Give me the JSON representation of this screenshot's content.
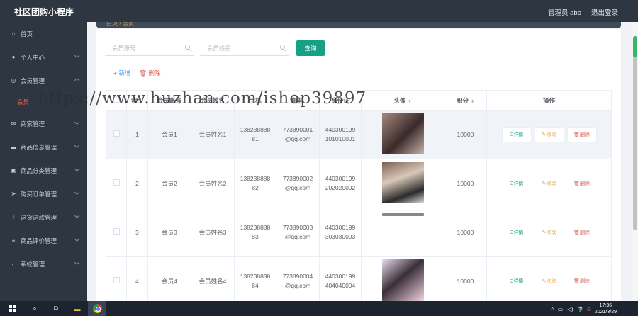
{
  "header": {
    "title": "社区团购小程序",
    "admin_label": "管理员 abo",
    "logout": "退出登录"
  },
  "sidebar": {
    "items": [
      {
        "label": "首页",
        "icon": "home-icon"
      },
      {
        "label": "个人中心",
        "icon": "user-icon"
      },
      {
        "label": "会员管理",
        "icon": "circle-icon",
        "expanded": true,
        "sub": "会员"
      },
      {
        "label": "商家管理",
        "icon": "mail-icon"
      },
      {
        "label": "商品信息管理",
        "icon": "monitor-icon"
      },
      {
        "label": "商品分类管理",
        "icon": "image-icon"
      },
      {
        "label": "购买订单管理",
        "icon": "send-icon"
      },
      {
        "label": "退货退款管理",
        "icon": "bulb-icon"
      },
      {
        "label": "商品评价管理",
        "icon": "list-icon"
      },
      {
        "label": "系统管理",
        "icon": "crop-icon"
      }
    ]
  },
  "breadcrumb": {
    "home": "首页",
    "current": "会员"
  },
  "search": {
    "account_placeholder": "会员账号",
    "name_placeholder": "会员姓名",
    "query_label": "查询"
  },
  "actions": {
    "add": "+ 新增",
    "delete": "删除"
  },
  "table": {
    "columns": [
      "",
      "索引",
      "会员账号",
      "会员姓名",
      "手机",
      "邮箱",
      "身份证",
      "头像",
      "积分",
      "操作"
    ],
    "rows": [
      {
        "index": "1",
        "account": "会员1",
        "name": "会员姓名1",
        "phone": [
          "138238888",
          "81"
        ],
        "email": [
          "773890001",
          "@qq.com"
        ],
        "idcard": [
          "440300199",
          "101010001"
        ],
        "points": "10000"
      },
      {
        "index": "2",
        "account": "会员2",
        "name": "会员姓名2",
        "phone": [
          "138238888",
          "82"
        ],
        "email": [
          "773890002",
          "@qq.com"
        ],
        "idcard": [
          "440300199",
          "202020002"
        ],
        "points": "10000"
      },
      {
        "index": "3",
        "account": "会员3",
        "name": "会员姓名3",
        "phone": [
          "138238888",
          "83"
        ],
        "email": [
          "773890003",
          "@qq.com"
        ],
        "idcard": [
          "440300199",
          "303030003"
        ],
        "points": "10000"
      },
      {
        "index": "4",
        "account": "会员4",
        "name": "会员姓名4",
        "phone": [
          "138238888",
          "84"
        ],
        "email": [
          "773890004",
          "@qq.com"
        ],
        "idcard": [
          "440300199",
          "404040004"
        ],
        "points": "10000"
      }
    ],
    "op_detail": "详情",
    "op_edit": "修改",
    "op_delete": "删除"
  },
  "watermark": "https://www.huzhan.com/ishop39897",
  "taskbar": {
    "time": "17:36",
    "date": "2021/3/29",
    "ime": "中"
  }
}
